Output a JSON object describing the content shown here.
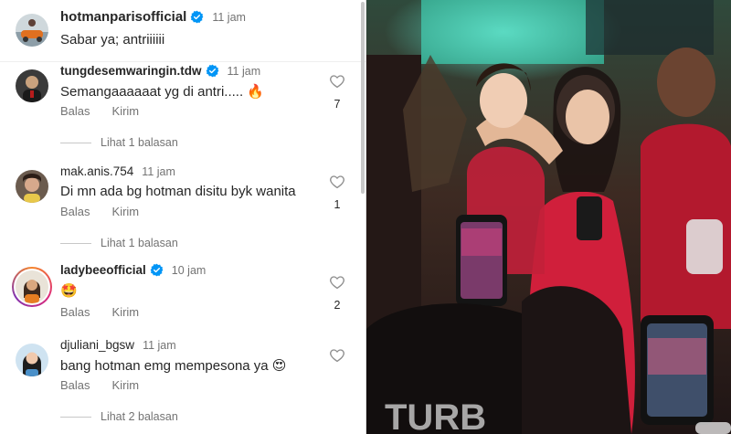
{
  "post": {
    "username": "hotmanparisofficial",
    "time": "11 jam",
    "caption": "Sabar ya; antriiiiii"
  },
  "comments": [
    {
      "username": "tungdesemwaringin.tdw",
      "verified": true,
      "time": "11 jam",
      "text": "Semangaaaaaat yg di antri..... 🔥",
      "reply_label": "Balas",
      "send_label": "Kirim",
      "likes": "7",
      "replies_label": "Lihat 1 balasan"
    },
    {
      "username": "mak.anis.754",
      "verified": false,
      "time": "11 jam",
      "text": "Di mn ada bg hotman disitu byk wanita",
      "reply_label": "Balas",
      "send_label": "Kirim",
      "likes": "1",
      "replies_label": "Lihat 1 balasan"
    },
    {
      "username": "ladybeeofficial",
      "verified": true,
      "time": "10 jam",
      "text": "🤩",
      "reply_label": "Balas",
      "send_label": "Kirim",
      "likes": "2",
      "replies_label": ""
    },
    {
      "username": "djuliani_bgsw",
      "verified": false,
      "time": "11 jam",
      "text": "bang hotman emg mempesona ya 😍",
      "reply_label": "Balas",
      "send_label": "Kirim",
      "likes": "",
      "replies_label": "Lihat 2 balasan"
    }
  ],
  "colors": {
    "verified": "#0095f6",
    "muted_text": "#737373",
    "story_ring": "#d6249f"
  },
  "icons": {
    "like": "heart-outline-icon",
    "verified": "verified-badge-icon"
  }
}
